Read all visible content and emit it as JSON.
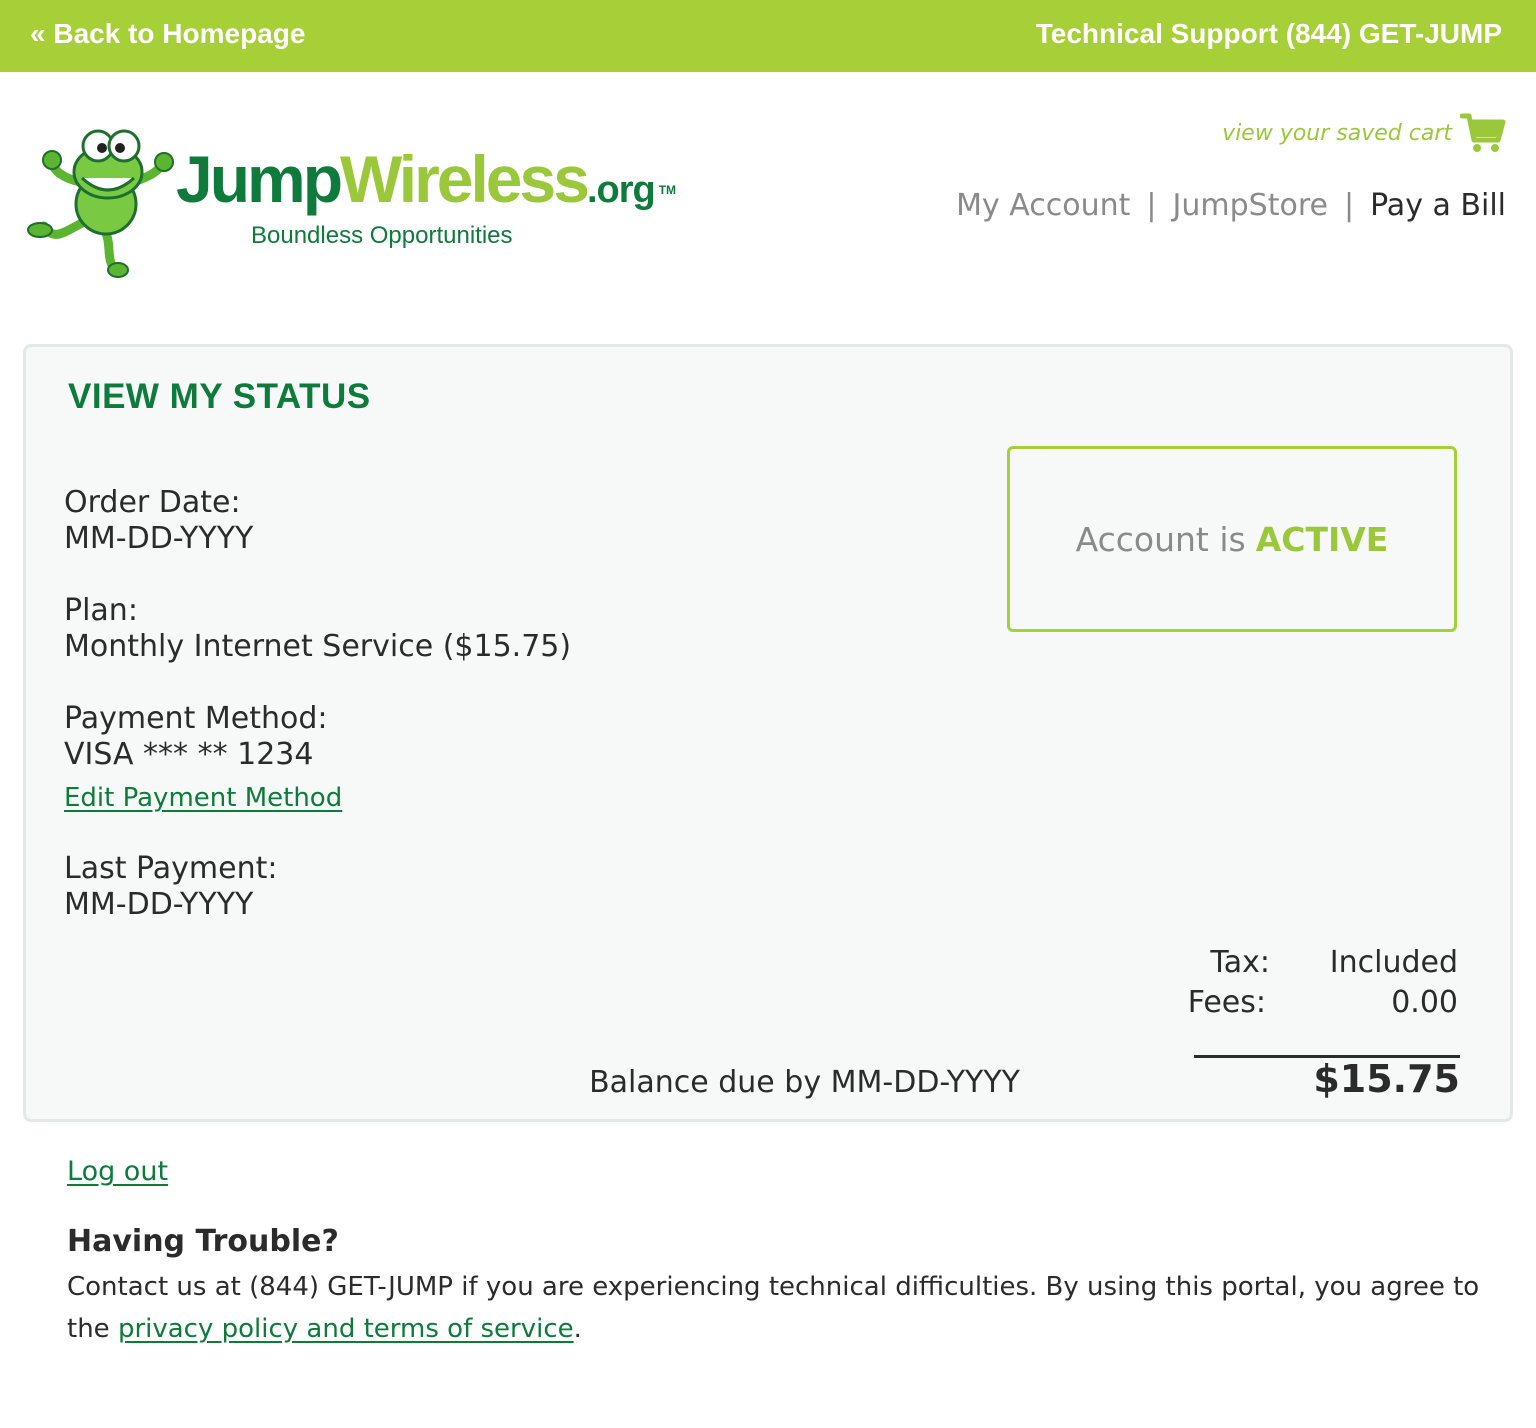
{
  "topbar": {
    "back_label": "« Back to Homepage",
    "support_label": "Technical Support (844) GET-JUMP"
  },
  "brand": {
    "name_part1": "Jump",
    "name_part2": "Wireless",
    "name_suffix": ".org",
    "trademark": "TM",
    "tagline": "Boundless Opportunities",
    "colors": {
      "dark_green": "#0e7a3c",
      "lime": "#9bc83a",
      "bar": "#a6cf38"
    }
  },
  "header": {
    "cart_label": "view your saved cart",
    "cart_icon": "shopping-cart-icon",
    "nav": {
      "my_account": "My Account",
      "separator": "|",
      "jumpstore": "JumpStore",
      "pay_bill": "Pay a Bill"
    }
  },
  "status": {
    "title": "VIEW MY STATUS",
    "order_date_label": "Order Date:",
    "order_date_value": "MM-DD-YYYY",
    "plan_label": "Plan:",
    "plan_value": "Monthly Internet Service ($15.75)",
    "payment_label": "Payment Method:",
    "payment_value": "VISA *** ** 1234",
    "edit_payment": "Edit Payment Method",
    "last_payment_label": "Last Payment:",
    "last_payment_value": "MM-DD-YYYY",
    "account_prefix": "Account is",
    "account_state": "ACTIVE",
    "tax_label": "Tax:",
    "tax_value": "Included",
    "fees_label": "Fees:",
    "fees_value": "0.00",
    "balance_label": "Balance due by MM-DD-YYYY",
    "balance_value": "$15.75"
  },
  "footer": {
    "logout": "Log out",
    "trouble_title": "Having Trouble?",
    "trouble_text": "Contact us at (844) GET-JUMP if you are experiencing technical difficulties. By using this portal, you agree to the ",
    "privacy_link": "privacy policy and terms of service",
    "trailing_period": "."
  }
}
